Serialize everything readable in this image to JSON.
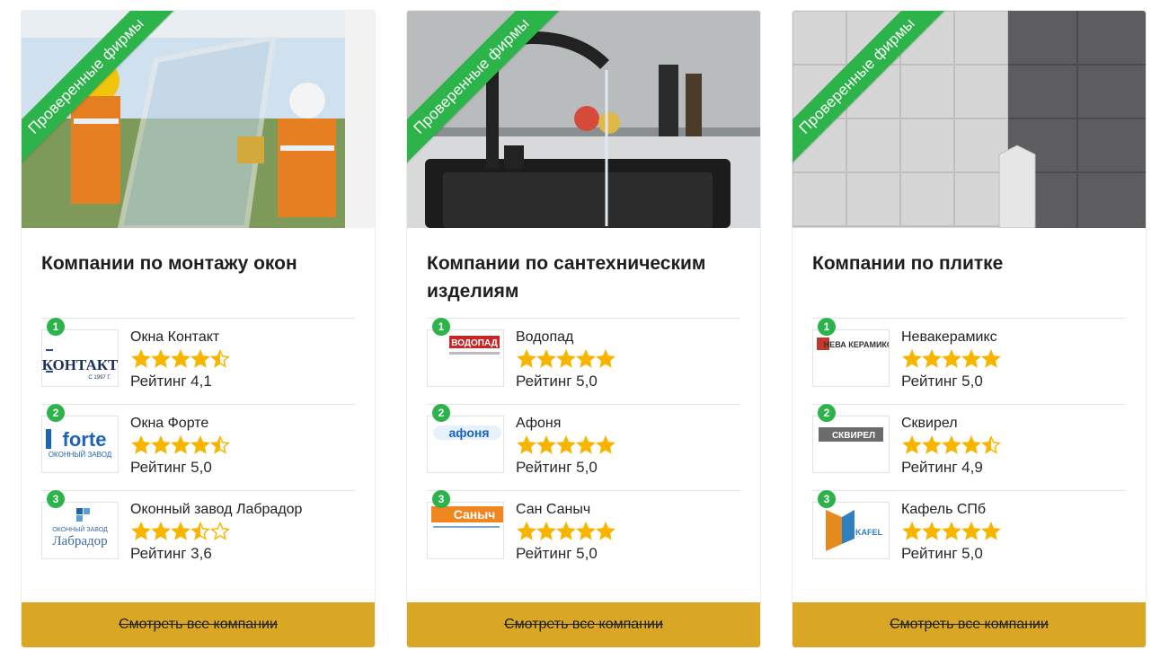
{
  "ribbon_label": "Проверенные фирмы",
  "rating_prefix": "Рейтинг",
  "cta_label": "Смотреть все компании",
  "colors": {
    "accent_green": "#2cb34a",
    "star": "#f7b500",
    "cta_bg": "#d9a724"
  },
  "cards": [
    {
      "title": "Компании по монтажу окон",
      "image": "window-installers-photo",
      "companies": [
        {
          "rank": "1",
          "name": "Окна Контакт",
          "stars": 4.5,
          "rating": "4,1",
          "logo_text": "КОНТАКТ",
          "logo_sub": "С 1997 Г."
        },
        {
          "rank": "2",
          "name": "Окна Форте",
          "stars": 4.5,
          "rating": "5,0",
          "logo_text": "forte",
          "logo_sub": "ОКОННЫЙ ЗАВОД"
        },
        {
          "rank": "3",
          "name": "Оконный завод Лабрадор",
          "stars": 3.5,
          "rating": "3,6",
          "logo_text": "Лабрадор",
          "logo_sub": "ОКОННЫЙ ЗАВОД"
        }
      ]
    },
    {
      "title": "Компании по сантехническим изделиям",
      "image": "kitchen-faucet-photo",
      "companies": [
        {
          "rank": "1",
          "name": "Водопад",
          "stars": 5,
          "rating": "5,0",
          "logo_text": "ВОДОПАД",
          "logo_sub": ""
        },
        {
          "rank": "2",
          "name": "Афоня",
          "stars": 5,
          "rating": "5,0",
          "logo_text": "афоня",
          "logo_sub": ""
        },
        {
          "rank": "3",
          "name": "Сан Саныч",
          "stars": 5,
          "rating": "5,0",
          "logo_text": "Саныч",
          "logo_sub": ""
        }
      ]
    },
    {
      "title": "Компании по плитке",
      "image": "bathroom-tile-photo",
      "companies": [
        {
          "rank": "1",
          "name": "Невакерамикс",
          "stars": 5,
          "rating": "5,0",
          "logo_text": "НЕВА КЕРАМИКС",
          "logo_sub": ""
        },
        {
          "rank": "2",
          "name": "Сквирел",
          "stars": 4.5,
          "rating": "4,9",
          "logo_text": "СКВИРЕЛ",
          "logo_sub": ""
        },
        {
          "rank": "3",
          "name": "Кафель СПб",
          "stars": 5,
          "rating": "5,0",
          "logo_text": "KAFEL",
          "logo_sub": ""
        }
      ]
    }
  ]
}
